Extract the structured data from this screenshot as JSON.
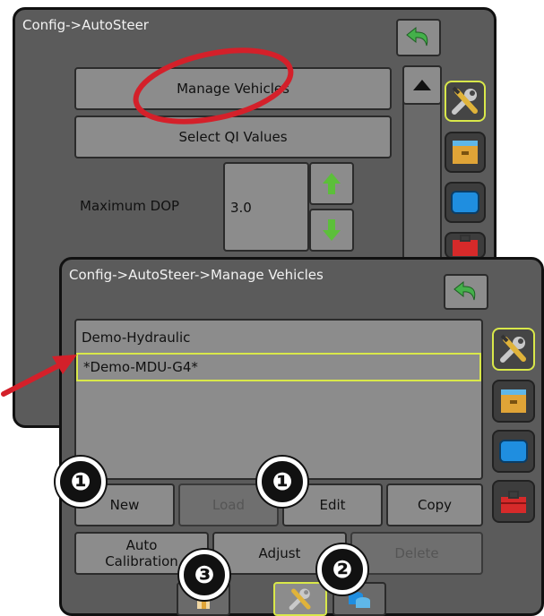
{
  "back_screen": {
    "title": "Config->AutoSteer",
    "buttons": {
      "manage_vehicles": "Manage Vehicles",
      "select_qi_values": "Select QI Values"
    },
    "max_dop": {
      "label": "Maximum DOP",
      "value": "3.0"
    }
  },
  "front_screen": {
    "title": "Config->AutoSteer->Manage Vehicles",
    "vehicles": [
      {
        "name": "Demo-Hydraulic",
        "selected": false
      },
      {
        "name": "*Demo-MDU-G4*",
        "selected": true
      }
    ],
    "buttons": {
      "new": "New",
      "load": "Load",
      "edit": "Edit",
      "copy": "Copy",
      "auto_calibration": "Auto Calibration",
      "adjust": "Adjust",
      "delete": "Delete"
    }
  },
  "callouts": {
    "one": "❶",
    "two": "❷",
    "three": "❸"
  },
  "colors": {
    "panel_bg": "#5b5b5b",
    "button_bg": "#8c8c8c",
    "highlight": "#d9e84a",
    "annotation_red": "#d4202a",
    "back_arrow_green": "#44b04a"
  },
  "icons": [
    "back-arrow-icon",
    "scroll-up-icon",
    "increment-up-icon",
    "decrement-down-icon",
    "wrench-screwdriver-icon",
    "storage-box-icon",
    "display-icon",
    "toolbox-icon",
    "home-icon",
    "database-icon"
  ]
}
